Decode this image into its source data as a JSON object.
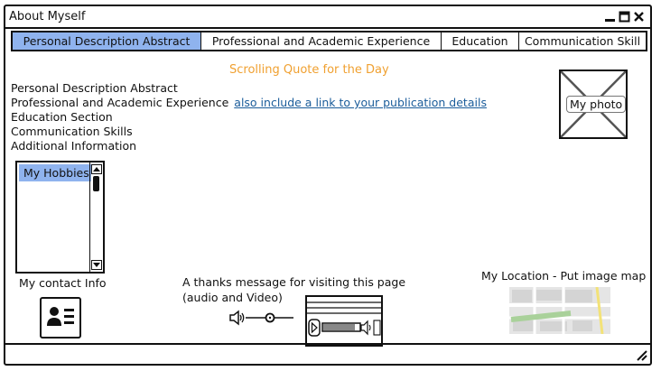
{
  "window": {
    "title": "About Myself"
  },
  "tabs": [
    {
      "label": "Personal Description Abstract",
      "active": true
    },
    {
      "label": "Professional and Academic Experience",
      "active": false
    },
    {
      "label": "Education",
      "active": false
    },
    {
      "label": "Communication Skill",
      "active": false
    }
  ],
  "quote": {
    "text": "Scrolling Quote for the Day",
    "color": "#f0a030"
  },
  "outline": {
    "items": [
      "Personal Description Abstract",
      "Professional and Academic Experience",
      "Education Section",
      "Communication Skills",
      "Additional Information"
    ],
    "publication_link": "also include a  link to your publication details"
  },
  "photo": {
    "label": "My photo"
  },
  "hobbies": {
    "items": [
      "My Hobbies"
    ]
  },
  "contact": {
    "label": "My contact Info",
    "icon": "contact-card-icon"
  },
  "thanks": {
    "line1": "A thanks message for visiting this page",
    "line2": "(audio and Video)"
  },
  "location": {
    "label": "My Location - Put image map"
  },
  "colors": {
    "selection": "#8fb3ee",
    "link": "#1a5c9a",
    "accent": "#f0a030"
  }
}
